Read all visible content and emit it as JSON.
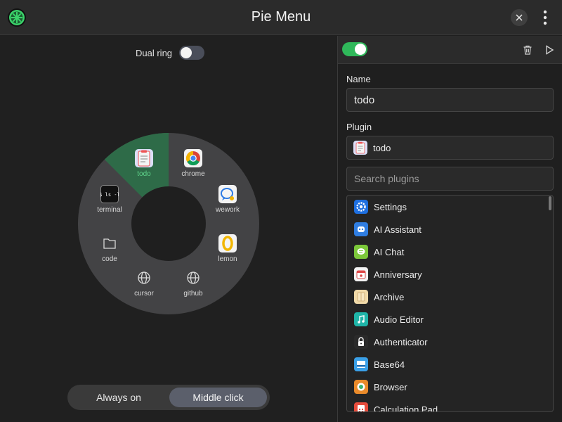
{
  "window": {
    "title": "Pie Menu"
  },
  "left": {
    "dual_ring_label": "Dual ring",
    "pie_items": [
      {
        "label": "todo",
        "icon": "clipboard-icon",
        "active": true
      },
      {
        "label": "chrome",
        "icon": "chrome-icon"
      },
      {
        "label": "wework",
        "icon": "chat-bubble-icon"
      },
      {
        "label": "lemon",
        "icon": "lemon-icon"
      },
      {
        "label": "github",
        "icon": "globe-icon"
      },
      {
        "label": "cursor",
        "icon": "globe-icon"
      },
      {
        "label": "code",
        "icon": "folder-icon"
      },
      {
        "label": "terminal",
        "icon": "terminal-icon",
        "icon_text": "$ ls -l"
      }
    ],
    "mode": {
      "options": [
        "Always on",
        "Middle click"
      ],
      "selected": "Middle click"
    }
  },
  "right": {
    "name_label": "Name",
    "name_value": "todo",
    "plugin_label": "Plugin",
    "plugin_value": "todo",
    "search_placeholder": "Search plugins",
    "plugins": [
      {
        "label": "Settings",
        "icon": "gear-icon",
        "color": "#1e6fe0"
      },
      {
        "label": "AI Assistant",
        "icon": "robot-icon",
        "color": "#2f7de1"
      },
      {
        "label": "AI Chat",
        "icon": "chat-icon",
        "color": "#7cc83a"
      },
      {
        "label": "Anniversary",
        "icon": "calendar-icon",
        "color": "#f2f2f2"
      },
      {
        "label": "Archive",
        "icon": "archive-icon",
        "color": "#f0d9a8"
      },
      {
        "label": "Audio Editor",
        "icon": "music-icon",
        "color": "#1fb5a8"
      },
      {
        "label": "Authenticator",
        "icon": "lock-icon",
        "color": "#2a2a2a"
      },
      {
        "label": "Base64",
        "icon": "base64-icon",
        "color": "#3aa0e8"
      },
      {
        "label": "Browser",
        "icon": "browser-icon",
        "color": "#e98a2a"
      },
      {
        "label": "Calculation Pad",
        "icon": "calculator-icon",
        "color": "#e74c3c"
      }
    ]
  },
  "colors": {
    "accent_green": "#2fb85a",
    "active_sector": "#2e6b48"
  }
}
